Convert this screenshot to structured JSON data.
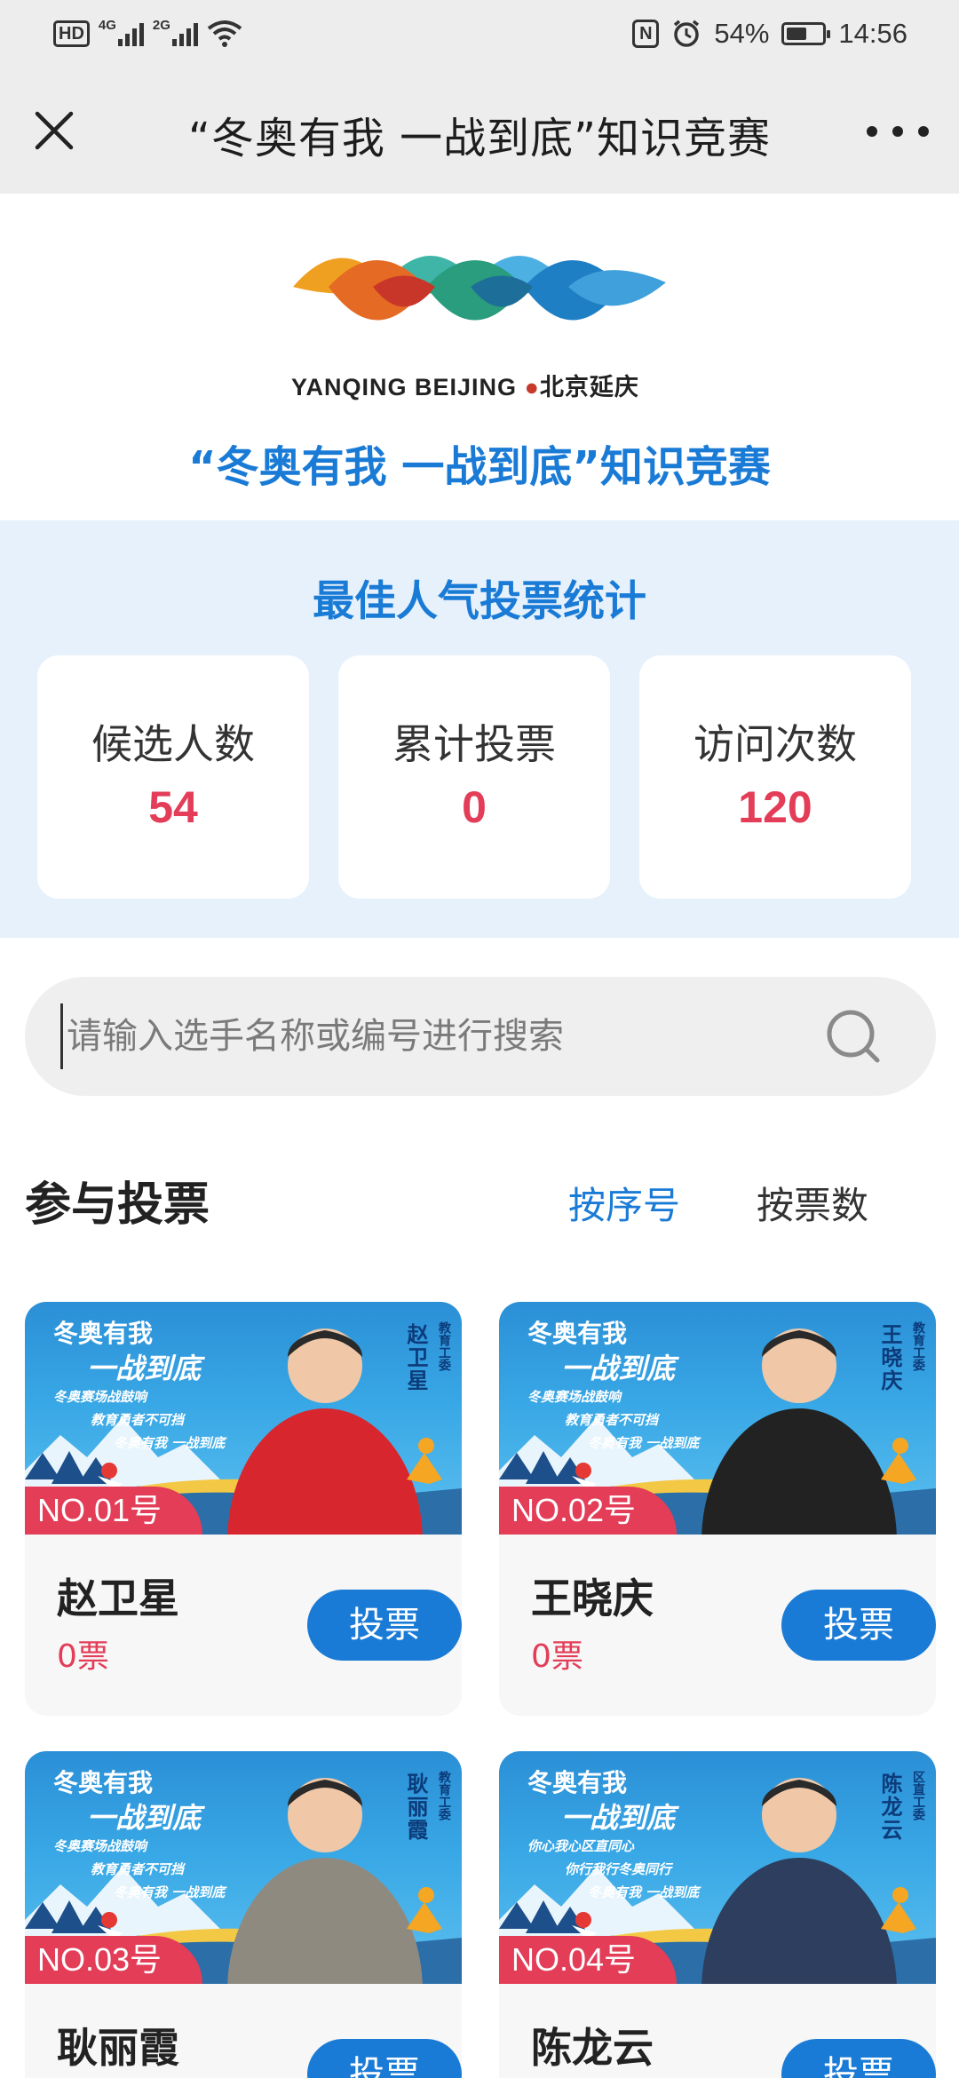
{
  "status_bar": {
    "hd": "HD",
    "net1": "4G",
    "net2": "2G",
    "battery": "54%",
    "time": "14:56"
  },
  "nav": {
    "title": "“冬奥有我 一战到底”知识竞赛"
  },
  "header": {
    "logo_text": "YANQING BEIJING",
    "logo_cn": "北京延庆",
    "title": "“冬奥有我 一战到底”知识竞赛"
  },
  "stats": {
    "title": "最佳人气投票统计",
    "items": [
      {
        "label": "候选人数",
        "value": "54"
      },
      {
        "label": "累计投票",
        "value": "0"
      },
      {
        "label": "访问次数",
        "value": "120"
      }
    ]
  },
  "search": {
    "placeholder": "请输入选手名称或编号进行搜索"
  },
  "section": {
    "title": "参与投票",
    "sort_by_number": "按序号",
    "sort_by_votes": "按票数"
  },
  "banner": {
    "slogan1": "冬奥有我",
    "slogan2": "一战到底"
  },
  "candidates": [
    {
      "no": "NO.01号",
      "name": "赵卫星",
      "votes": "0票",
      "vote_label": "投票",
      "org": "教育工委",
      "lines": [
        "冬奥赛场战鼓响",
        "教育勇者不可挡",
        "冬奥有我 一战到底"
      ],
      "shirt": "#d8262e"
    },
    {
      "no": "NO.02号",
      "name": "王晓庆",
      "votes": "0票",
      "vote_label": "投票",
      "org": "教育工委",
      "lines": [
        "冬奥赛场战鼓响",
        "教育勇者不可挡",
        "冬奥有我 一战到底"
      ],
      "shirt": "#222222"
    },
    {
      "no": "NO.03号",
      "name": "耿丽霞",
      "votes": "",
      "vote_label": "投票",
      "org": "教育工委",
      "lines": [
        "冬奥赛场战鼓响",
        "教育勇者不可挡",
        "冬奥有我 一战到底"
      ],
      "shirt": "#8f8a80"
    },
    {
      "no": "NO.04号",
      "name": "陈龙云",
      "votes": "",
      "vote_label": "投票",
      "org": "区直工委",
      "lines": [
        "你心我心区直同心",
        "你行我行冬奥同行",
        "冬奥有我 一战到底"
      ],
      "shirt": "#2d3e5e"
    }
  ]
}
